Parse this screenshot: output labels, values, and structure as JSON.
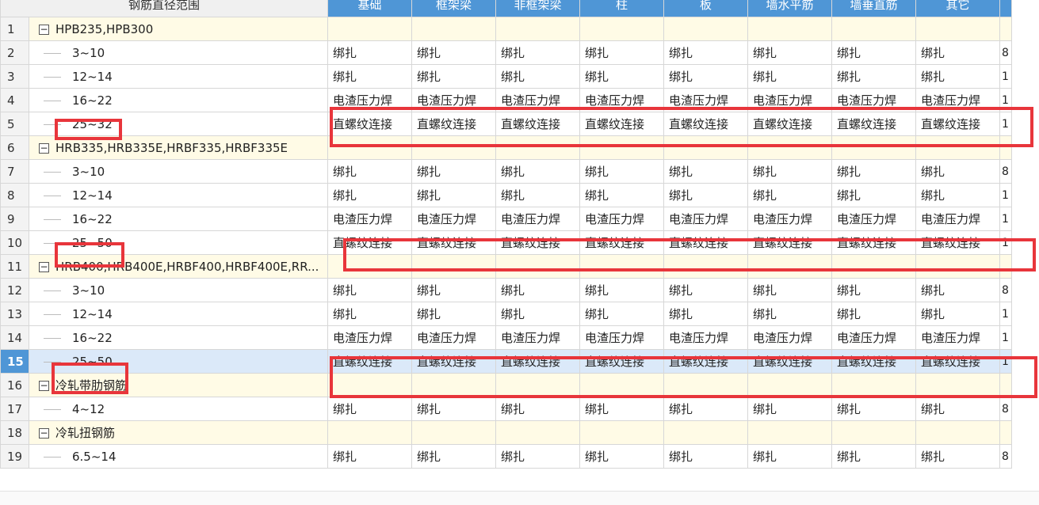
{
  "header": {
    "first_col": "钢筋直径范围",
    "columns": [
      "基础",
      "框架梁",
      "非框架梁",
      "柱",
      "板",
      "墙水平筋",
      "墙垂直筋",
      "其它"
    ]
  },
  "rows": [
    {
      "num": "1",
      "type": "group",
      "name": "HPB235,HPB300",
      "toggle": "−"
    },
    {
      "num": "2",
      "type": "item",
      "name": "3~10",
      "values": [
        "绑扎",
        "绑扎",
        "绑扎",
        "绑扎",
        "绑扎",
        "绑扎",
        "绑扎",
        "绑扎"
      ],
      "last": "8"
    },
    {
      "num": "3",
      "type": "item",
      "name": "12~14",
      "values": [
        "绑扎",
        "绑扎",
        "绑扎",
        "绑扎",
        "绑扎",
        "绑扎",
        "绑扎",
        "绑扎"
      ],
      "last": "1"
    },
    {
      "num": "4",
      "type": "item",
      "name": "16~22",
      "values": [
        "电渣压力焊",
        "电渣压力焊",
        "电渣压力焊",
        "电渣压力焊",
        "电渣压力焊",
        "电渣压力焊",
        "电渣压力焊",
        "电渣压力焊"
      ],
      "last": "1"
    },
    {
      "num": "5",
      "type": "item",
      "name": "25~32",
      "values": [
        "直螺纹连接",
        "直螺纹连接",
        "直螺纹连接",
        "直螺纹连接",
        "直螺纹连接",
        "直螺纹连接",
        "直螺纹连接",
        "直螺纹连接"
      ],
      "last": "1"
    },
    {
      "num": "6",
      "type": "group",
      "name": "HRB335,HRB335E,HRBF335,HRBF335E",
      "toggle": "−"
    },
    {
      "num": "7",
      "type": "item",
      "name": "3~10",
      "values": [
        "绑扎",
        "绑扎",
        "绑扎",
        "绑扎",
        "绑扎",
        "绑扎",
        "绑扎",
        "绑扎"
      ],
      "last": "8"
    },
    {
      "num": "8",
      "type": "item",
      "name": "12~14",
      "values": [
        "绑扎",
        "绑扎",
        "绑扎",
        "绑扎",
        "绑扎",
        "绑扎",
        "绑扎",
        "绑扎"
      ],
      "last": "1"
    },
    {
      "num": "9",
      "type": "item",
      "name": "16~22",
      "values": [
        "电渣压力焊",
        "电渣压力焊",
        "电渣压力焊",
        "电渣压力焊",
        "电渣压力焊",
        "电渣压力焊",
        "电渣压力焊",
        "电渣压力焊"
      ],
      "last": "1"
    },
    {
      "num": "10",
      "type": "item",
      "name": "25~50",
      "values": [
        "直螺纹连接",
        "直螺纹连接",
        "直螺纹连接",
        "直螺纹连接",
        "直螺纹连接",
        "直螺纹连接",
        "直螺纹连接",
        "直螺纹连接"
      ],
      "last": "1"
    },
    {
      "num": "11",
      "type": "group",
      "name": "HRB400,HRB400E,HRBF400,HRBF400E,RR...",
      "toggle": "−"
    },
    {
      "num": "12",
      "type": "item",
      "name": "3~10",
      "values": [
        "绑扎",
        "绑扎",
        "绑扎",
        "绑扎",
        "绑扎",
        "绑扎",
        "绑扎",
        "绑扎"
      ],
      "last": "8"
    },
    {
      "num": "13",
      "type": "item",
      "name": "12~14",
      "values": [
        "绑扎",
        "绑扎",
        "绑扎",
        "绑扎",
        "绑扎",
        "绑扎",
        "绑扎",
        "绑扎"
      ],
      "last": "1"
    },
    {
      "num": "14",
      "type": "item",
      "name": "16~22",
      "values": [
        "电渣压力焊",
        "电渣压力焊",
        "电渣压力焊",
        "电渣压力焊",
        "电渣压力焊",
        "电渣压力焊",
        "电渣压力焊",
        "电渣压力焊"
      ],
      "last": "1"
    },
    {
      "num": "15",
      "type": "item",
      "name": "25~50",
      "selected": true,
      "values": [
        "直螺纹连接",
        "直螺纹连接",
        "直螺纹连接",
        "直螺纹连接",
        "直螺纹连接",
        "直螺纹连接",
        "直螺纹连接",
        "直螺纹连接"
      ],
      "last": "1"
    },
    {
      "num": "16",
      "type": "group",
      "name": "冷轧带肋钢筋",
      "toggle": "−"
    },
    {
      "num": "17",
      "type": "item",
      "name": "4~12",
      "values": [
        "绑扎",
        "绑扎",
        "绑扎",
        "绑扎",
        "绑扎",
        "绑扎",
        "绑扎",
        "绑扎"
      ],
      "last": "8"
    },
    {
      "num": "18",
      "type": "group",
      "name": "冷轧扭钢筋",
      "toggle": "−"
    },
    {
      "num": "19",
      "type": "item",
      "name": "6.5~14",
      "values": [
        "绑扎",
        "绑扎",
        "绑扎",
        "绑扎",
        "绑扎",
        "绑扎",
        "绑扎",
        "绑扎"
      ],
      "last": "8"
    }
  ],
  "colors": {
    "header_blue": "#4f96d6",
    "group_row_bg": "#fffbe6",
    "selected_row_bg": "#dbe9f9",
    "highlight_red": "#e8353b"
  }
}
